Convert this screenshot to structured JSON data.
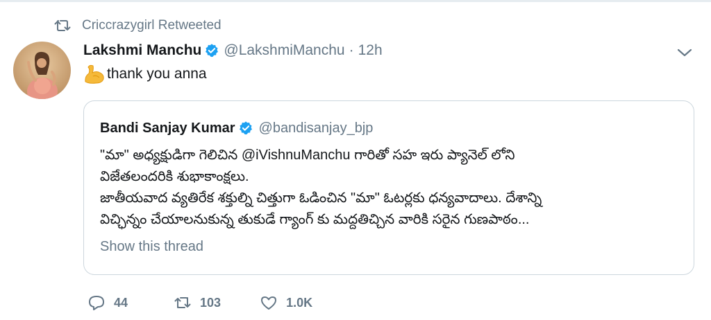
{
  "retweet_context": {
    "label": "Criccrazygirl Retweeted",
    "icon": "retweet-icon"
  },
  "tweet": {
    "author_name": "Lakshmi Manchu",
    "author_handle": "@LakshmiManchu",
    "separator": "·",
    "time": "12h",
    "text": "thank you anna",
    "emoji": "flexed-biceps-emoji"
  },
  "quoted_tweet": {
    "author_name": "Bandi Sanjay Kumar",
    "author_handle": "@bandisanjay_bjp",
    "lines": [
      "\"మా\" అధ్యక్షుడిగా గెలిచిన @iVishnuManchu గారితో సహ ఇరు ప్యానెల్ లోని",
      "విజేతలందరికి శుభాకాంక్షలు.",
      "జాతీయవాద వ్యతిరేక శక్తుల్ని చిత్తుగా ఓడించిన \"మా\" ఓటర్లకు ధన్యవాదాలు. దేశాన్ని",
      "విచ్ఛిన్నం చేయాలనుకున్న తుకుడే గ్యాంగ్ కు మద్దతిచ్చిన వారికి సరైన గుణపాఠం..."
    ],
    "show_thread": "Show this thread"
  },
  "actions": {
    "replies": "44",
    "retweets": "103",
    "likes": "1.0K"
  },
  "colors": {
    "verified": "#1da1f2",
    "muted": "#657786",
    "text": "#14171a",
    "border": "#ccd6dd"
  }
}
